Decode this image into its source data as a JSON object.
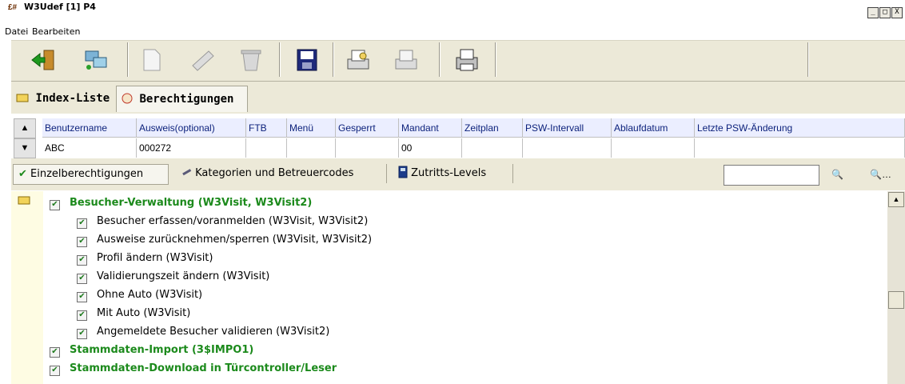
{
  "window": {
    "title": "W3Udef [1] P4",
    "icon_text": "£#",
    "controls": [
      "_",
      "□",
      "X"
    ]
  },
  "menu": [
    "Datei",
    "Bearbeiten"
  ],
  "toolbar": {
    "icons": [
      "exit-door-icon",
      "network-computer-icon",
      "new-document-icon",
      "edit-pen-icon",
      "delete-bin-icon",
      "save-disk-icon",
      "print-preview-icon",
      "print-folder-icon",
      "printer-icon"
    ]
  },
  "tabs": {
    "index_label": "Index-Liste",
    "berecht_label": "Berechtigungen"
  },
  "grid": {
    "columns": [
      "Benutzername",
      "Ausweis(optional)",
      "FTB",
      "Menü",
      "Gesperrt",
      "Mandant",
      "Zeitplan",
      "PSW-Intervall",
      "Ablaufdatum",
      "Letzte PSW-Änderung"
    ],
    "row": [
      "ABC",
      "000272",
      "",
      "",
      "",
      "00",
      "",
      "",
      "",
      ""
    ]
  },
  "subtabs": {
    "einzel": "Einzelberechtigungen",
    "kategorien": "Kategorien und Betreuercodes",
    "zutritts": "Zutritts-Levels"
  },
  "search": {
    "value": "",
    "find_label": "🔍",
    "find_more_label": "…"
  },
  "tree": [
    {
      "label": "Besucher-Verwaltung (W3Visit, W3Visit2)",
      "level": 0,
      "checked": true
    },
    {
      "label": "Besucher erfassen/voranmelden (W3Visit, W3Visit2)",
      "level": 1,
      "checked": true
    },
    {
      "label": "Ausweise zurücknehmen/sperren (W3Visit, W3Visit2)",
      "level": 1,
      "checked": true
    },
    {
      "label": "Profil ändern (W3Visit)",
      "level": 1,
      "checked": true
    },
    {
      "label": "Validierungszeit ändern (W3Visit)",
      "level": 1,
      "checked": true
    },
    {
      "label": "Ohne Auto (W3Visit)",
      "level": 1,
      "checked": true
    },
    {
      "label": "Mit Auto (W3Visit)",
      "level": 1,
      "checked": true
    },
    {
      "label": "Angemeldete Besucher validieren (W3Visit2)",
      "level": 1,
      "checked": true
    },
    {
      "label": "Stammdaten-Import (3$IMPO1)",
      "level": 0,
      "checked": true
    },
    {
      "label": "Stammdaten-Download in Türcontroller/Leser",
      "level": 0,
      "checked": true
    }
  ],
  "colors": {
    "tree_parent": "#1c8a1c",
    "grid_header_bg": "#ebeeff",
    "toolbar_bg": "#ece9d8"
  }
}
